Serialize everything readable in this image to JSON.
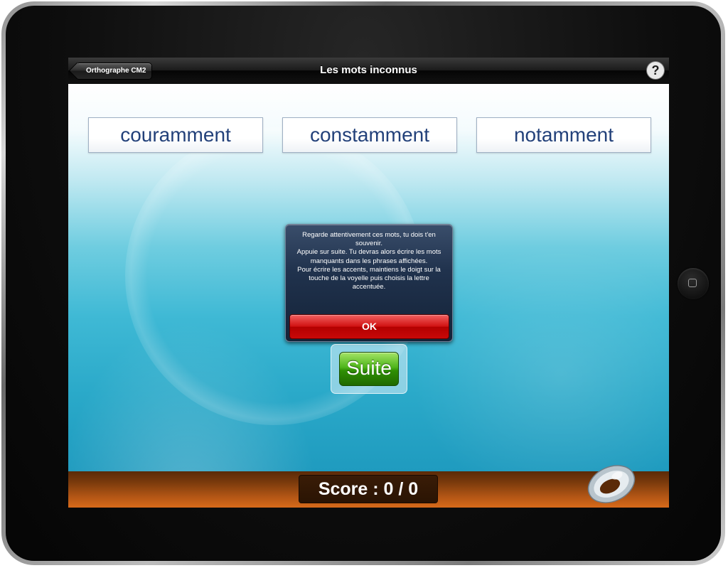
{
  "navbar": {
    "back_label": "Orthographe CM2",
    "title": "Les mots inconnus",
    "help_label": "?"
  },
  "words": [
    "couramment",
    "constamment",
    "notamment"
  ],
  "alert": {
    "message_lines": [
      "Regarde attentivement ces mots, tu dois t'en souvenir.",
      "Appuie sur suite. Tu devras alors écrire les mots manquants dans les phrases affichées.",
      "Pour écrire les accents, maintiens le doigt sur la touche de la voyelle puis choisis la lettre accentuée."
    ],
    "ok_label": "OK"
  },
  "suite_label": "Suite",
  "score_label": "Score : 0 / 0",
  "colors": {
    "ok_button": "#d01010",
    "suite_button": "#3d9f0c",
    "bottombar": "#b35615",
    "word_text": "#23417a"
  },
  "icons": {
    "help": "question-circle-icon",
    "corner": "disc-ring-icon"
  }
}
